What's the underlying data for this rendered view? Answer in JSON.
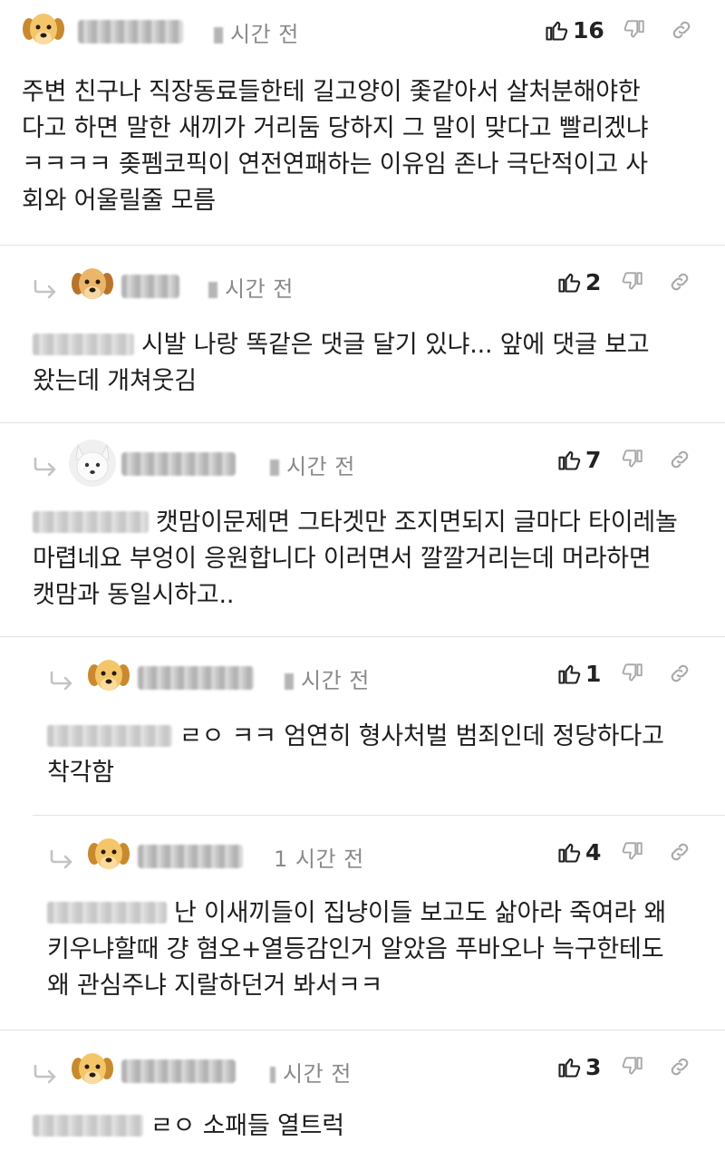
{
  "comments": [
    {
      "time": "시간 전",
      "likes": "16",
      "lines": [
        "주변 친구나 직장동료들한테 길고양이 좇같아서 살처분해야한",
        "다고 하면 말한 새끼가 거리둠 당하지 그 말이 맞다고 빨리겠냐",
        "ㅋㅋㅋㅋ 좆펨코픽이 연전연패하는 이유임 존나 극단적이고 사",
        "회와 어울릴줄 모름"
      ]
    },
    {
      "time": "시간 전",
      "likes": "2",
      "lines": [
        "시발 나랑 똑같은 댓글 달기 있냐... 앞에 댓글 보고",
        "왔는데 개쳐웃김"
      ]
    },
    {
      "time": "시간 전",
      "likes": "7",
      "lines": [
        "캣맘이문제면 그타겟만 조지면되지 글마다 타이레놀",
        "마렵네요 부엉이 응원합니다 이러면서 깔깔거리는데 머라하면",
        "캣맘과 동일시하고.."
      ]
    },
    {
      "time": "시간 전",
      "likes": "1",
      "lines": [
        "ㄹㅇ ㅋㅋ 엄연히 형사처벌 범죄인데 정당하다고",
        "착각함"
      ]
    },
    {
      "time": "1 시간 전",
      "likes": "4",
      "lines": [
        "난 이새끼들이 집냥이들 보고도 삶아라 죽여라 왜",
        "키우냐할때 걍 혐오+열등감인거 알았음 푸바오나 늑구한테도",
        "왜 관심주냐 지랄하던거 봐서ㅋㅋ"
      ]
    },
    {
      "time": "시간 전",
      "likes": "3",
      "lines": [
        "ㄹㅇ 소패들 열트럭"
      ]
    }
  ]
}
